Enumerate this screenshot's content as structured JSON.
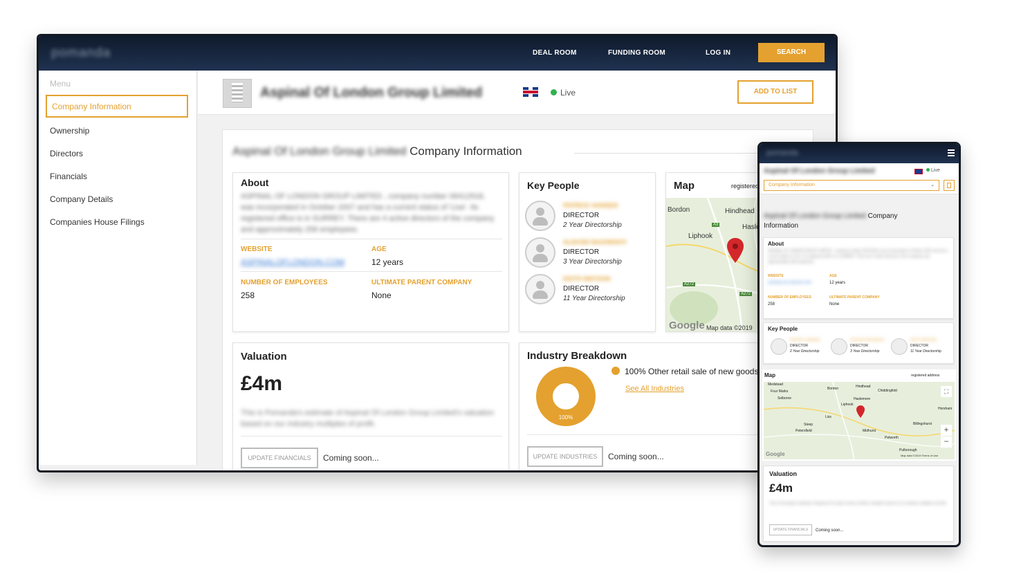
{
  "brand": {
    "logo": "pomanda",
    "accent": "#e4a12f",
    "navy": "#1a2a42"
  },
  "nav": {
    "deal_room": "DEAL ROOM",
    "funding_room": "FUNDING ROOM",
    "log_in": "LOG IN",
    "search": "SEARCH"
  },
  "sidebar": {
    "menu_label": "Menu",
    "items": [
      {
        "label": "Company Information"
      },
      {
        "label": "Ownership"
      },
      {
        "label": "Directors"
      },
      {
        "label": "Financials"
      },
      {
        "label": "Company Details"
      },
      {
        "label": "Companies House Filings"
      }
    ]
  },
  "company": {
    "name": "Aspinal Of London Group Limited",
    "status": "Live",
    "add_to_list": "ADD TO LIST"
  },
  "main": {
    "section_title_suffix": "Company Information"
  },
  "about": {
    "title": "About",
    "description": "ASPINAL OF LONDON GROUP LIMITED , company number 06412918, was incorporated in October 2007 and has a current status of 'Live'. Its registered office is in SURREY. There are 4 active directors of the company and approximately 258 employees.",
    "website_label": "WEBSITE",
    "website_value": "ASPINALOFLONDON.COM",
    "age_label": "AGE",
    "age_value": "12 years",
    "employees_label": "NUMBER OF EMPLOYEES",
    "employees_value": "258",
    "parent_label": "ULTIMATE PARENT COMPANY",
    "parent_value": "None"
  },
  "key_people": {
    "title": "Key People",
    "people": [
      {
        "name": "PATRICK HANSEN",
        "role": "DIRECTOR",
        "tenure": "2 Year Directorship"
      },
      {
        "name": "ALEKSEI BAZHENOV",
        "role": "DIRECTOR",
        "tenure": "3 Year Directorship"
      },
      {
        "name": "KEITH WATSON",
        "role": "DIRECTOR",
        "tenure": "11 Year Directorship"
      }
    ]
  },
  "map": {
    "title": "Map",
    "dropdown": "registered address",
    "places": [
      "Bordon",
      "Hindhead",
      "Haslemere",
      "Liphook",
      "A3",
      "A272",
      "A272"
    ],
    "google": "Google",
    "attribution": "Map data ©2019",
    "mobile_places": [
      "Medstead",
      "Four Marks",
      "Selborne",
      "Bordon",
      "Hindhead",
      "Chiddingfold",
      "Liphook",
      "Haslemere",
      "Liss",
      "Steep",
      "Petersfield",
      "Midhurst",
      "Petworth",
      "Billingshurst",
      "Pulborough",
      "Horsham"
    ],
    "mobile_attribution": "Map data ©2019   Terms of Use"
  },
  "valuation": {
    "title": "Valuation",
    "amount": "£4m",
    "description": "This is Pomanda's estimate of Aspinal Of London Group Limited's valuation based on our industry multiples of profit.",
    "button": "UPDATE FINANCIALS",
    "status": "Coming soon..."
  },
  "industry": {
    "title": "Industry Breakdown",
    "legend": "100% Other retail sale of new goods",
    "link": "See All Industries",
    "button": "UPDATE INDUSTRIES",
    "status": "Coming soon...",
    "chart_data": {
      "type": "pie",
      "categories": [
        "Other retail sale of new goods"
      ],
      "values": [
        100
      ],
      "labels": [
        "100%"
      ]
    }
  },
  "mobile": {
    "dropdown": "Company Information",
    "section_title": "Company Information",
    "menu_icon": "hamburger-icon",
    "bookmark_icon": "bookmark-icon"
  }
}
